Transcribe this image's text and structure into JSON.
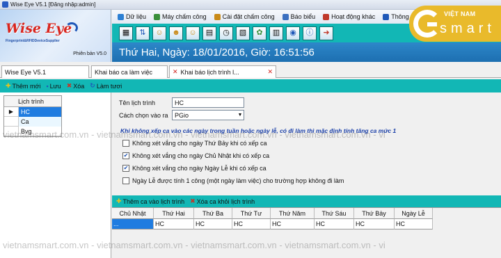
{
  "window": {
    "title": "Wise Eye V5.1 [Đăng nhập:admin]"
  },
  "logo": {
    "wordmark": "Wise Eye",
    "tagline": "Fingerprint&RFIDDeviceSupplier",
    "version": "Phiên bản V5.0"
  },
  "menu": [
    {
      "label": "Dữ liệu",
      "color": "#2d7fd3"
    },
    {
      "label": "Máy chấm công",
      "color": "#3a8f3a"
    },
    {
      "label": "Cài đặt chấm công",
      "color": "#c98a18"
    },
    {
      "label": "Báo biểu",
      "color": "#3a6fc0"
    },
    {
      "label": "Hoạt động khác",
      "color": "#c0392b"
    },
    {
      "label": "Thông tin",
      "color": "#1f58b8"
    }
  ],
  "toolbar_icons": [
    "film-icon",
    "transfer-arrows-icon",
    "people-icon",
    "group-icon",
    "users-icon",
    "calendar-icon",
    "clock-icon",
    "document-calendar-icon",
    "settings-icon",
    "report-icon",
    "user-search-icon",
    "info-icon",
    "exit-icon"
  ],
  "datebar": {
    "text": "Thứ Hai, Ngày: 18/01/2016, Giờ: 16:51:56"
  },
  "brand": {
    "name": "VIỆT NAM",
    "word": "smart",
    "accent": "#e9ba2b"
  },
  "tabs": [
    {
      "label": "Wise Eye V5.1"
    },
    {
      "label": "Khai báo ca làm việc"
    },
    {
      "label": "Khai báo lịch trình l..."
    }
  ],
  "actions": {
    "add": "Thêm mới",
    "save": "Lưu",
    "delete": "Xóa",
    "refresh": "Làm tươi"
  },
  "schedule_list": {
    "header": "Lịch trình",
    "rows": [
      "HC",
      "Ca",
      "Bvg"
    ]
  },
  "form": {
    "name_label": "Tên lịch trình",
    "name_value": "HC",
    "method_label": "Cách chọn vào ra",
    "method_value": "PGio",
    "note": "Khi không xếp ca vào các ngày trong tuần hoặc ngày lễ, có đi làm thì mặc định tính tăng ca mức 1",
    "checks": [
      {
        "label": "Không xét vắng cho ngày Thứ Bảy khi có xếp ca",
        "checked": false
      },
      {
        "label": "Không xét vắng cho ngày Chủ Nhật khi có xếp ca",
        "checked": true
      },
      {
        "label": "Không xét vắng cho ngày Ngày Lễ khi có xếp ca",
        "checked": true
      },
      {
        "label": "Ngày Lễ được tính 1 công (một ngày làm việc) cho trường hợp không đi làm",
        "checked": false
      }
    ]
  },
  "schedule_actions": {
    "add": "Thêm ca vào lịch trình",
    "remove": "Xóa ca khỏi lịch trình"
  },
  "grid": {
    "columns": [
      "Chủ Nhật",
      "Thứ Hai",
      "Thứ Ba",
      "Thứ Tư",
      "Thứ Năm",
      "Thứ Sáu",
      "Thứ Bảy",
      "Ngày Lễ"
    ],
    "row": [
      "...",
      "HC",
      "HC",
      "HC",
      "HC",
      "HC",
      "HC",
      "HC"
    ]
  },
  "watermark": "vietnamsmart.com.vn - vietnamsmart.com.vn - vietnamsmart.com.vn - vietnamsmart.com.vn - vi"
}
